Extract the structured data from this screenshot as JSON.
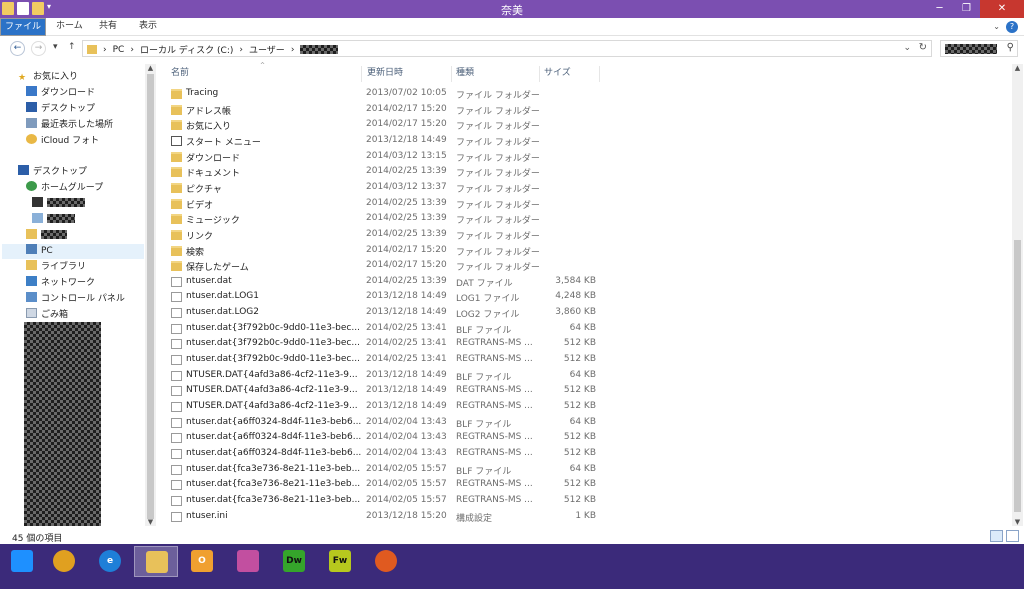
{
  "window": {
    "title": "奈美"
  },
  "ribbon": {
    "tabs": [
      "ファイル",
      "ホーム",
      "共有",
      "表示"
    ],
    "help": "?"
  },
  "address": {
    "crumbs": [
      "PC",
      "ローカル ディスク (C:)",
      "ユーザー"
    ]
  },
  "nav_pane": {
    "favorites_header": "お気に入り",
    "favorites": [
      "ダウンロード",
      "デスクトップ",
      "最近表示した場所",
      "iCloud フォト"
    ],
    "desktop": "デスクトップ",
    "homegroup": "ホームグループ",
    "pc": "PC",
    "items": [
      "ライブラリ",
      "ネットワーク",
      "コントロール パネル",
      "ごみ箱"
    ]
  },
  "columns": {
    "name": "名前",
    "date": "更新日時",
    "type": "種類",
    "size": "サイズ"
  },
  "files": [
    {
      "name": "Tracing",
      "date": "2013/07/02 10:05",
      "type": "ファイル フォルダー",
      "size": "",
      "kind": "folder"
    },
    {
      "name": "アドレス帳",
      "date": "2014/02/17 15:20",
      "type": "ファイル フォルダー",
      "size": "",
      "kind": "folder"
    },
    {
      "name": "お気に入り",
      "date": "2014/02/17 15:20",
      "type": "ファイル フォルダー",
      "size": "",
      "kind": "folder"
    },
    {
      "name": "スタート メニュー",
      "date": "2013/12/18 14:49",
      "type": "ファイル フォルダー",
      "size": "",
      "kind": "shortcut"
    },
    {
      "name": "ダウンロード",
      "date": "2014/03/12 13:15",
      "type": "ファイル フォルダー",
      "size": "",
      "kind": "folder"
    },
    {
      "name": "ドキュメント",
      "date": "2014/02/25 13:39",
      "type": "ファイル フォルダー",
      "size": "",
      "kind": "folder"
    },
    {
      "name": "ピクチャ",
      "date": "2014/03/12 13:37",
      "type": "ファイル フォルダー",
      "size": "",
      "kind": "folder"
    },
    {
      "name": "ビデオ",
      "date": "2014/02/25 13:39",
      "type": "ファイル フォルダー",
      "size": "",
      "kind": "folder"
    },
    {
      "name": "ミュージック",
      "date": "2014/02/25 13:39",
      "type": "ファイル フォルダー",
      "size": "",
      "kind": "folder"
    },
    {
      "name": "リンク",
      "date": "2014/02/25 13:39",
      "type": "ファイル フォルダー",
      "size": "",
      "kind": "folder"
    },
    {
      "name": "検索",
      "date": "2014/02/17 15:20",
      "type": "ファイル フォルダー",
      "size": "",
      "kind": "folder"
    },
    {
      "name": "保存したゲーム",
      "date": "2014/02/17 15:20",
      "type": "ファイル フォルダー",
      "size": "",
      "kind": "folder"
    },
    {
      "name": "ntuser.dat",
      "date": "2014/02/25 13:39",
      "type": "DAT ファイル",
      "size": "3,584 KB",
      "kind": "file"
    },
    {
      "name": "ntuser.dat.LOG1",
      "date": "2013/12/18 14:49",
      "type": "LOG1 ファイル",
      "size": "4,248 KB",
      "kind": "file"
    },
    {
      "name": "ntuser.dat.LOG2",
      "date": "2013/12/18 14:49",
      "type": "LOG2 ファイル",
      "size": "3,860 KB",
      "kind": "file"
    },
    {
      "name": "ntuser.dat{3f792b0c-9dd0-11e3-bec...",
      "date": "2014/02/25 13:41",
      "type": "BLF ファイル",
      "size": "64 KB",
      "kind": "file"
    },
    {
      "name": "ntuser.dat{3f792b0c-9dd0-11e3-bec...",
      "date": "2014/02/25 13:41",
      "type": "REGTRANS-MS ...",
      "size": "512 KB",
      "kind": "file"
    },
    {
      "name": "ntuser.dat{3f792b0c-9dd0-11e3-bec...",
      "date": "2014/02/25 13:41",
      "type": "REGTRANS-MS ...",
      "size": "512 KB",
      "kind": "file"
    },
    {
      "name": "NTUSER.DAT{4afd3a86-4cf2-11e3-9...",
      "date": "2013/12/18 14:49",
      "type": "BLF ファイル",
      "size": "64 KB",
      "kind": "file"
    },
    {
      "name": "NTUSER.DAT{4afd3a86-4cf2-11e3-9...",
      "date": "2013/12/18 14:49",
      "type": "REGTRANS-MS ...",
      "size": "512 KB",
      "kind": "file"
    },
    {
      "name": "NTUSER.DAT{4afd3a86-4cf2-11e3-9...",
      "date": "2013/12/18 14:49",
      "type": "REGTRANS-MS ...",
      "size": "512 KB",
      "kind": "file"
    },
    {
      "name": "ntuser.dat{a6ff0324-8d4f-11e3-beb6...",
      "date": "2014/02/04 13:43",
      "type": "BLF ファイル",
      "size": "64 KB",
      "kind": "file"
    },
    {
      "name": "ntuser.dat{a6ff0324-8d4f-11e3-beb6...",
      "date": "2014/02/04 13:43",
      "type": "REGTRANS-MS ...",
      "size": "512 KB",
      "kind": "file"
    },
    {
      "name": "ntuser.dat{a6ff0324-8d4f-11e3-beb6...",
      "date": "2014/02/04 13:43",
      "type": "REGTRANS-MS ...",
      "size": "512 KB",
      "kind": "file"
    },
    {
      "name": "ntuser.dat{fca3e736-8e21-11e3-beb...",
      "date": "2014/02/05 15:57",
      "type": "BLF ファイル",
      "size": "64 KB",
      "kind": "file"
    },
    {
      "name": "ntuser.dat{fca3e736-8e21-11e3-beb...",
      "date": "2014/02/05 15:57",
      "type": "REGTRANS-MS ...",
      "size": "512 KB",
      "kind": "file"
    },
    {
      "name": "ntuser.dat{fca3e736-8e21-11e3-beb...",
      "date": "2014/02/05 15:57",
      "type": "REGTRANS-MS ...",
      "size": "512 KB",
      "kind": "file"
    },
    {
      "name": "ntuser.ini",
      "date": "2013/12/18 15:20",
      "type": "構成設定",
      "size": "1 KB",
      "kind": "file"
    }
  ],
  "status": {
    "count": "45 個の項目"
  },
  "taskbar": {
    "apps": [
      {
        "icon": "windows-start-icon",
        "label": "",
        "color": "#1e90ff"
      },
      {
        "icon": "chrome-icon",
        "label": "",
        "color": "#e0a020"
      },
      {
        "icon": "internet-explorer-icon",
        "label": "e",
        "color": "#1e7fd8"
      },
      {
        "icon": "file-explorer-icon",
        "label": "",
        "color": "#e8c15a"
      },
      {
        "icon": "outlook-icon",
        "label": "O",
        "color": "#f0a030"
      },
      {
        "icon": "paint-icon",
        "label": "",
        "color": "#c24fa0"
      },
      {
        "icon": "dreamweaver-icon",
        "label": "Dw",
        "color": "#35a52b"
      },
      {
        "icon": "fireworks-icon",
        "label": "Fw",
        "color": "#b7c81e"
      },
      {
        "icon": "firefox-icon",
        "label": "",
        "color": "#e05a20"
      }
    ]
  }
}
